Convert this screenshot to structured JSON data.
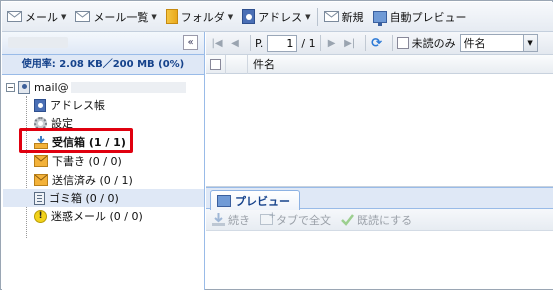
{
  "toolbar": {
    "mail": "メール",
    "mail_list": "メール一覧",
    "folder": "フォルダ",
    "address": "アドレス",
    "new": "新規",
    "auto_preview": "自動プレビュー"
  },
  "sidebar": {
    "usage": "使用率: 2.08 KB／200 MB (0%)",
    "account": "mail@",
    "items": [
      {
        "label": "アドレス帳"
      },
      {
        "label": "設定"
      },
      {
        "label": "受信箱 (1 / 1)"
      },
      {
        "label": "下書き (0 / 0)"
      },
      {
        "label": "送信済み (0 / 1)"
      },
      {
        "label": "ゴミ箱 (0 / 0)"
      },
      {
        "label": "迷惑メール (0 / 0)"
      }
    ]
  },
  "pager": {
    "page_prefix": "P.",
    "page_value": "1",
    "page_total": "/ 1",
    "unread_only": "未読のみ",
    "sort_field": "件名"
  },
  "grid": {
    "subject_header": "件名"
  },
  "preview": {
    "tab": "プレビュー",
    "continue": "続き",
    "open_tab": "タブで全文",
    "mark_read": "既読にする"
  },
  "colors": {
    "highlight": "#e0000f",
    "selected_row": "#dfe8f6",
    "accent": "#15428b"
  }
}
